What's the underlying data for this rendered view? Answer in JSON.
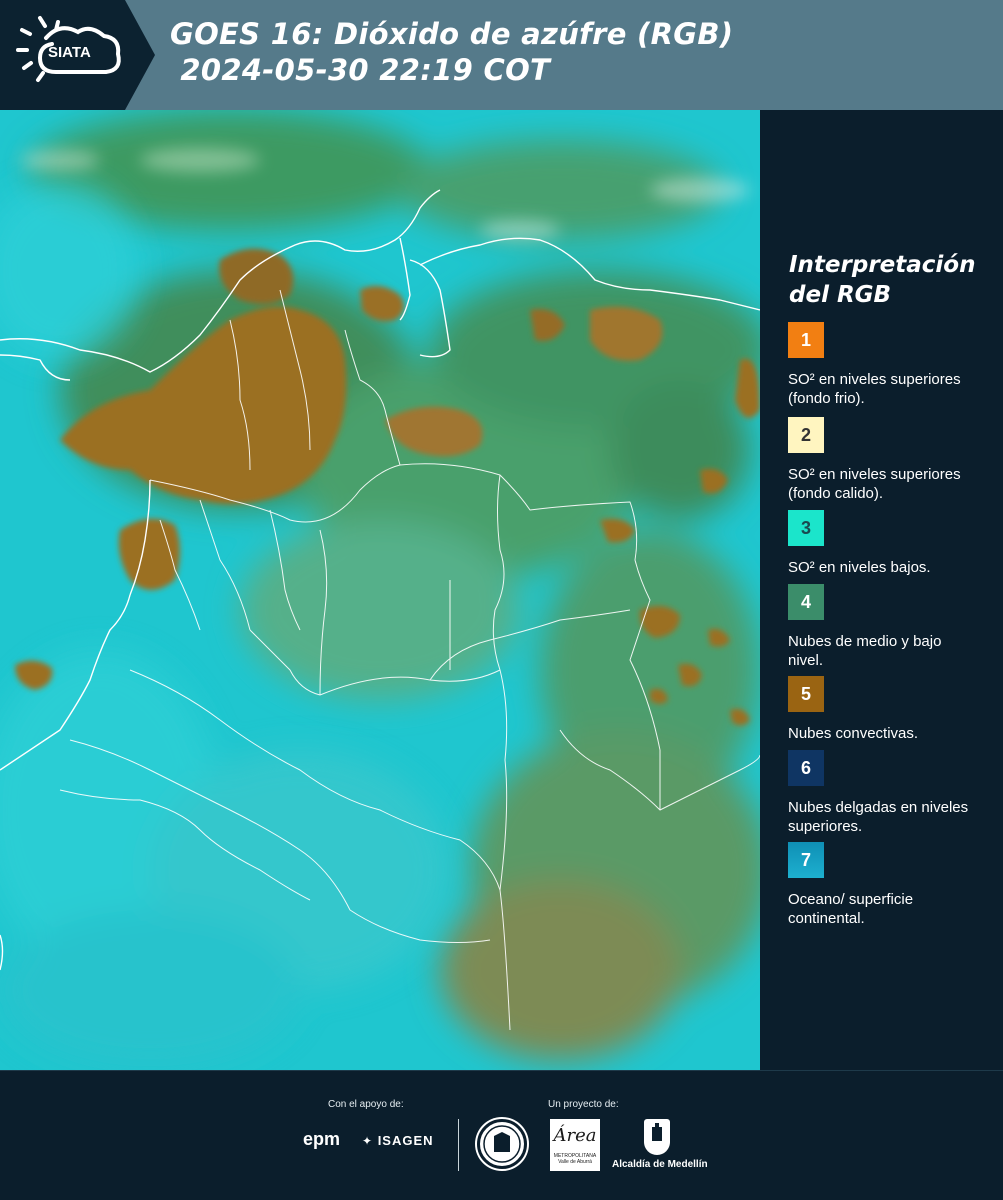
{
  "header": {
    "logo_text": "SIATA",
    "title_line1": "GOES 16: Dióxido de azúfre (RGB)",
    "title_line2": " 2024-05-30 22:19 COT"
  },
  "legend": {
    "title": "Interpretación del RGB",
    "items": [
      {
        "number": "1",
        "label": "SO² en niveles superiores (fondo frio).",
        "color": "#f27f12"
      },
      {
        "number": "2",
        "label": "SO² en niveles superiores (fondo calido).",
        "color": "#fff5c0"
      },
      {
        "number": "3",
        "label": "SO² en niveles bajos.",
        "color": "#1be5cb"
      },
      {
        "number": "4",
        "label": "Nubes de medio y bajo nivel.",
        "color": "#3b8d6a"
      },
      {
        "number": "5",
        "label": "Nubes convectivas.",
        "color": "#9a6412"
      },
      {
        "number": "6",
        "label": "Nubes delgadas en niveles superiores.",
        "color": "#0f3563"
      },
      {
        "number": "7",
        "label": "Oceano/ superficie continental.",
        "color": "#0f8fb5"
      }
    ]
  },
  "footer": {
    "support_label": "Con el apoyo de:",
    "project_label": "Un proyecto de:",
    "sponsor1": "epm",
    "sponsor2": "ISAGEN",
    "partner1_title": "Área",
    "partner1_subtitle": "METROPOLITANA Valle de Aburrá",
    "partner2": "Alcaldía de Medellín"
  },
  "colors": {
    "ocean": "#1fc6cf",
    "land_green": "#3f8e5c",
    "convective": "#9b6f22",
    "header_bg": "#557a8a",
    "panel_bg": "#0b1e2c"
  }
}
